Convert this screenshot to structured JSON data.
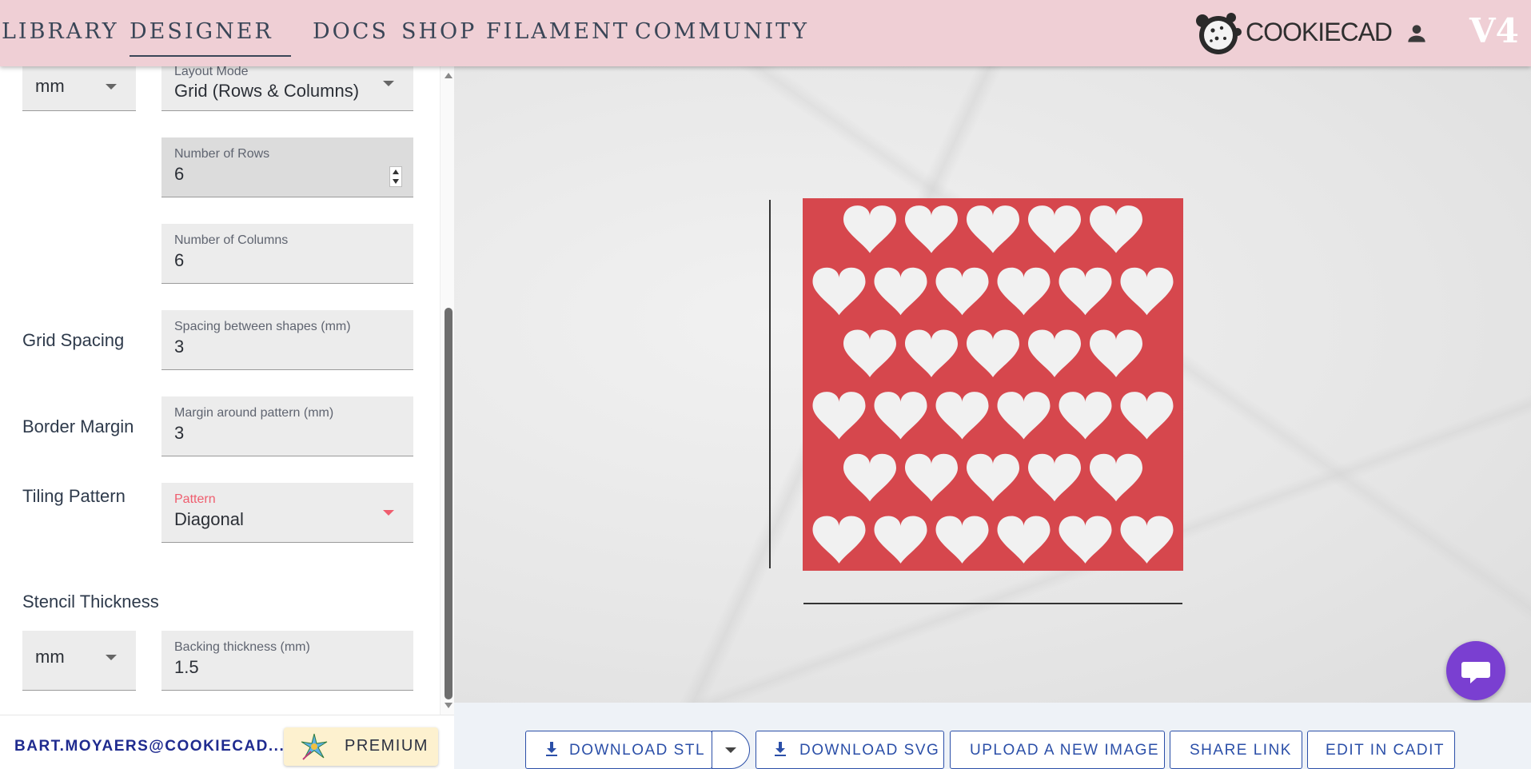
{
  "nav": {
    "items": [
      "LIBRARY",
      "DESIGNER",
      "DOCS",
      "SHOP FILAMENT",
      "COMMUNITY"
    ],
    "active": "DESIGNER",
    "brand": "COOKIECAD",
    "version": "V4"
  },
  "form": {
    "units_top": "mm",
    "layout_mode": {
      "label": "Layout Mode",
      "value": "Grid (Rows & Columns)"
    },
    "rows": {
      "label": "Number of Rows",
      "value": "6"
    },
    "columns": {
      "label": "Number of Columns",
      "value": "6"
    },
    "grid_spacing": {
      "section": "Grid Spacing",
      "label": "Spacing between shapes (mm)",
      "value": "3"
    },
    "border_margin": {
      "section": "Border Margin",
      "label": "Margin around pattern (mm)",
      "value": "3"
    },
    "tiling": {
      "section": "Tiling Pattern",
      "label": "Pattern",
      "value": "Diagonal"
    },
    "thickness": {
      "section": "Stencil Thickness",
      "units": "mm",
      "label": "Backing thickness (mm)",
      "value": "1.5"
    }
  },
  "account": {
    "email": "BART.MOYAERS@COOKIECAD....",
    "premium": "PREMIUM"
  },
  "preview": {
    "stencil_color": "#d6474d",
    "shape_color": "#f1f1f1",
    "shape": "heart",
    "rows": [
      5,
      6,
      5,
      6,
      5,
      6
    ]
  },
  "toolbar": {
    "download_stl": "DOWNLOAD STL",
    "download_svg": "DOWNLOAD SVG",
    "upload": "UPLOAD A NEW IMAGE",
    "share": "SHARE LINK",
    "edit": "EDIT IN CADIT"
  },
  "colors": {
    "nav_bg": "#efcfd5",
    "accent": "#2b4fa8",
    "chat": "#7a3fd1"
  }
}
